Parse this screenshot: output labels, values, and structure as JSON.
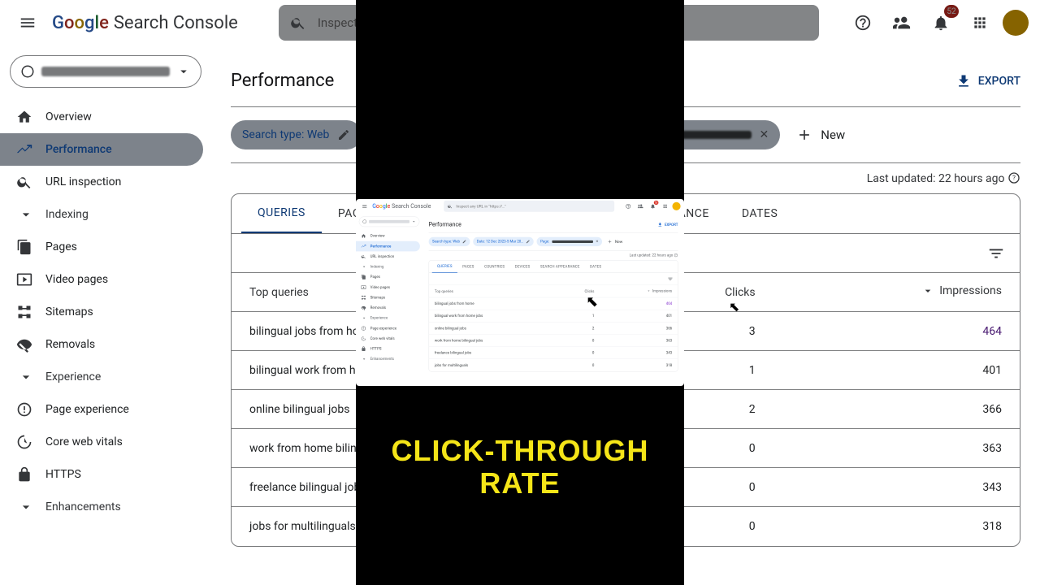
{
  "header": {
    "product": "Search Console",
    "search_placeholder": "Inspect any URL in \"https://…\"",
    "notif_count": "52"
  },
  "sidebar": {
    "overview": "Overview",
    "performance": "Performance",
    "url_inspection": "URL inspection",
    "sec_indexing": "Indexing",
    "pages": "Pages",
    "video_pages": "Video pages",
    "sitemaps": "Sitemaps",
    "removals": "Removals",
    "sec_experience": "Experience",
    "page_experience": "Page experience",
    "core_web_vitals": "Core web vitals",
    "https": "HTTPS",
    "sec_enhancements": "Enhancements"
  },
  "main": {
    "title": "Performance",
    "export": "EXPORT",
    "chip_searchtype": "Search type: Web",
    "chip_date": "Date: 12 Dec 2023-5 Mar 20…",
    "chip_page": "Page:",
    "new": "New",
    "updated": "Last updated: 22 hours ago"
  },
  "tabs": {
    "queries": "QUERIES",
    "pages": "PAGES",
    "countries": "COUNTRIES",
    "devices": "DEVICES",
    "search_appearance": "SEARCH APPEARANCE",
    "dates": "DATES"
  },
  "table": {
    "col_query": "Top queries",
    "col_clicks": "Clicks",
    "col_imp": "Impressions",
    "rows": [
      {
        "q": "bilingual jobs from home",
        "c": "3",
        "i": "464"
      },
      {
        "q": "bilingual work from home jobs",
        "c": "1",
        "i": "401"
      },
      {
        "q": "online bilingual jobs",
        "c": "2",
        "i": "366"
      },
      {
        "q": "work from home bilingual jobs",
        "c": "0",
        "i": "363"
      },
      {
        "q": "freelance bilingual jobs",
        "c": "0",
        "i": "343"
      },
      {
        "q": "jobs for multilinguals",
        "c": "0",
        "i": "318"
      }
    ]
  },
  "caption": "CLICK-THROUGH RATE"
}
